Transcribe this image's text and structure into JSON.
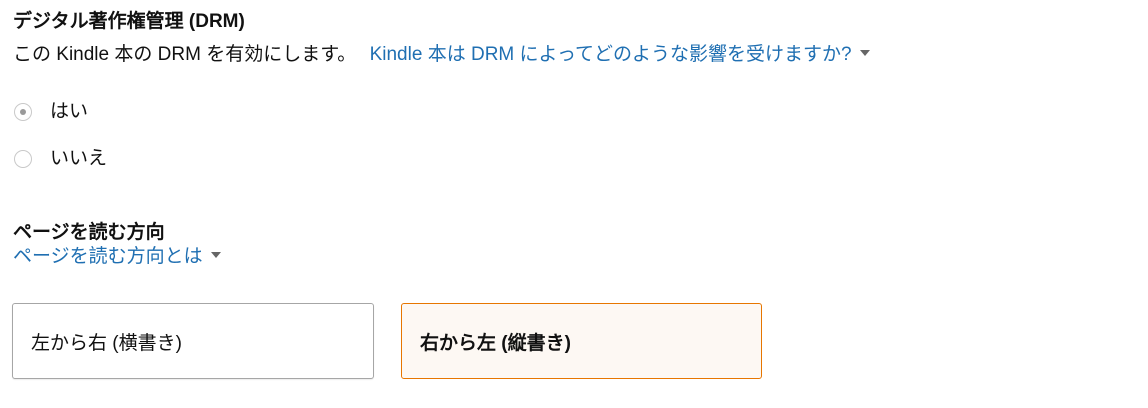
{
  "drm": {
    "title": "デジタル著作権管理 (DRM)",
    "description": "この Kindle 本の DRM を有効にします。",
    "help_link": "Kindle 本は DRM によってどのような影響を受けますか?",
    "options": [
      {
        "label": "はい",
        "selected": true
      },
      {
        "label": "いいえ",
        "selected": false
      }
    ]
  },
  "reading_direction": {
    "title": "ページを読む方向",
    "help_link": "ページを読む方向とは",
    "options": [
      {
        "label": "左から右 (横書き)",
        "selected": false
      },
      {
        "label": "右から左 (縦書き)",
        "selected": true
      }
    ]
  },
  "colors": {
    "link": "#1f6fb2",
    "selected_border": "#e77600",
    "selected_background": "#fdf8f3"
  },
  "icons": {
    "dropdown": "caret-down-icon"
  }
}
